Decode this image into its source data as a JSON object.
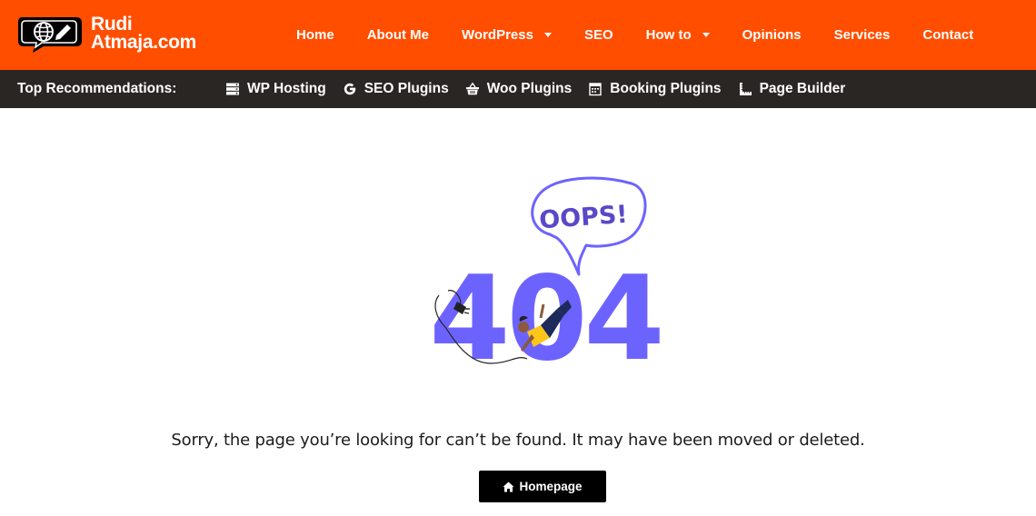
{
  "brand": {
    "line1": "Rudi",
    "line2": "Atmaja.com",
    "logo_icon": "globe-pen-speech-icon"
  },
  "nav": {
    "items": [
      {
        "label": "Home",
        "has_dropdown": false
      },
      {
        "label": "About Me",
        "has_dropdown": false
      },
      {
        "label": "WordPress",
        "has_dropdown": true
      },
      {
        "label": "SEO",
        "has_dropdown": false
      },
      {
        "label": "How to",
        "has_dropdown": true
      },
      {
        "label": "Opinions",
        "has_dropdown": false
      },
      {
        "label": "Services",
        "has_dropdown": false
      },
      {
        "label": "Contact",
        "has_dropdown": false
      }
    ]
  },
  "recommendations": {
    "title": "Top Recommendations:",
    "items": [
      {
        "label": "WP Hosting",
        "icon": "server-icon"
      },
      {
        "label": "SEO Plugins",
        "icon": "google-icon"
      },
      {
        "label": "Woo Plugins",
        "icon": "basket-icon"
      },
      {
        "label": "Booking Plugins",
        "icon": "calendar-icon"
      },
      {
        "label": "Page Builder",
        "icon": "ruler-icon"
      }
    ]
  },
  "error": {
    "bubble_text": "OOPS!",
    "code_text": "404",
    "message": "Sorry, the page you’re looking for can’t be found. It may have been moved or deleted.",
    "button_label": "Homepage",
    "button_icon": "home-icon"
  },
  "colors": {
    "header_bg": "#ff4e00",
    "recbar_bg": "#2a2624",
    "accent_purple": "#6c63ff",
    "button_bg": "#000000"
  }
}
